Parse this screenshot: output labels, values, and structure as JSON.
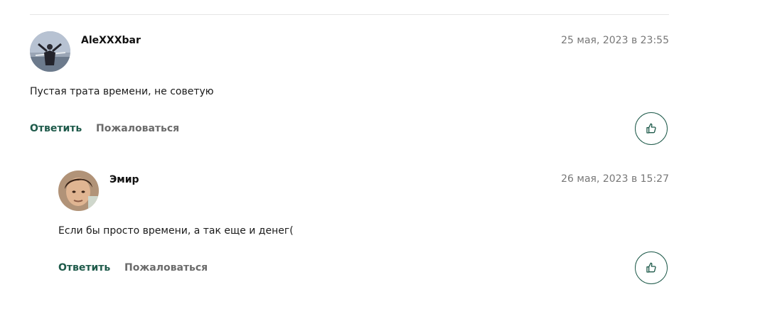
{
  "comments": [
    {
      "author": "AleXXXbar",
      "date": "25 мая, 2023 в 23:55",
      "text": "Пустая трата времени, не советую",
      "reply_label": "Ответить",
      "report_label": "Пожаловаться"
    },
    {
      "author": "Эмир",
      "date": "26 мая, 2023 в 15:27",
      "text": "Если бы просто времени, а так еще и денег(",
      "reply_label": "Ответить",
      "report_label": "Пожаловаться"
    }
  ],
  "icons": {
    "like": "thumbs-up-icon"
  },
  "colors": {
    "accent": "#1e5a4a",
    "muted": "#6b6b6b"
  }
}
